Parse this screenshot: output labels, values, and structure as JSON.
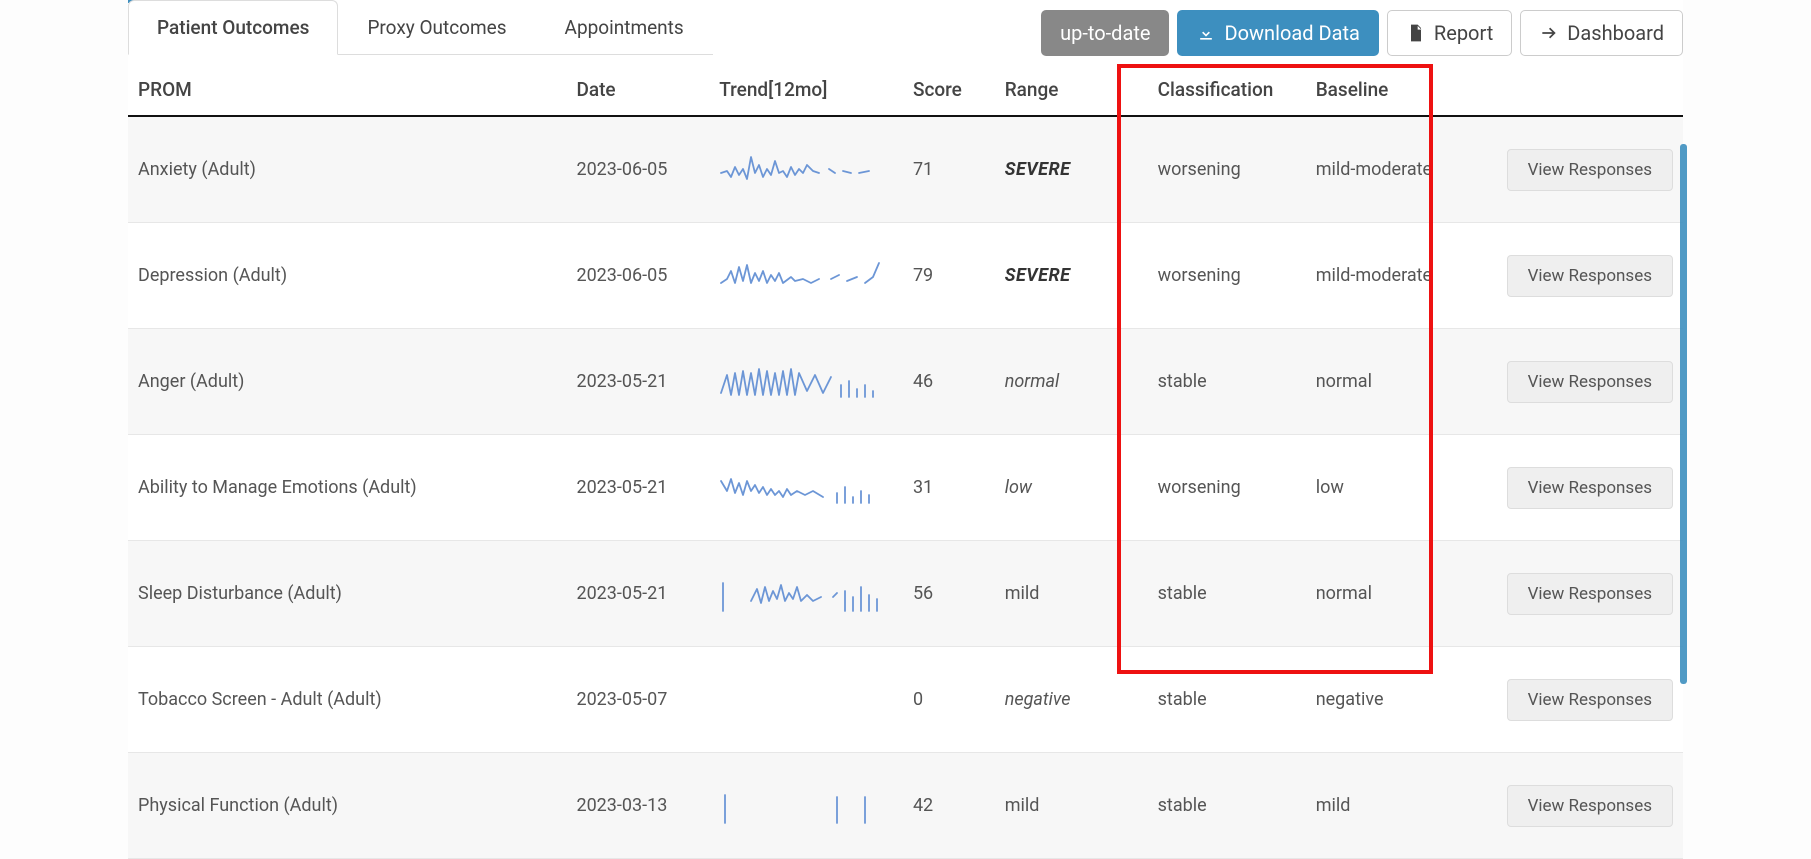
{
  "tabs": {
    "patient": "Patient Outcomes",
    "proxy": "Proxy Outcomes",
    "appts": "Appointments"
  },
  "actions": {
    "uptodate": "up-to-date",
    "download": "Download Data",
    "report": "Report",
    "dashboard": "Dashboard"
  },
  "columns": {
    "prom": "PROM",
    "date": "Date",
    "trend": "Trend[12mo]",
    "score": "Score",
    "range": "Range",
    "classification": "Classification",
    "baseline": "Baseline"
  },
  "view_label": "View Responses",
  "rows": [
    {
      "prom": "Anxiety (Adult)",
      "date": "2023-06-05",
      "score": "71",
      "range": "SEVERE",
      "range_style": "severe",
      "classification": "worsening",
      "baseline": "mild-moderate"
    },
    {
      "prom": "Depression (Adult)",
      "date": "2023-06-05",
      "score": "79",
      "range": "SEVERE",
      "range_style": "severe",
      "classification": "worsening",
      "baseline": "mild-moderate"
    },
    {
      "prom": "Anger (Adult)",
      "date": "2023-05-21",
      "score": "46",
      "range": "normal",
      "range_style": "italic",
      "classification": "stable",
      "baseline": "normal"
    },
    {
      "prom": "Ability to Manage Emotions (Adult)",
      "date": "2023-05-21",
      "score": "31",
      "range": "low",
      "range_style": "italic",
      "classification": "worsening",
      "baseline": "low"
    },
    {
      "prom": "Sleep Disturbance (Adult)",
      "date": "2023-05-21",
      "score": "56",
      "range": "mild",
      "range_style": "plain",
      "classification": "stable",
      "baseline": "normal"
    },
    {
      "prom": "Tobacco Screen - Adult (Adult)",
      "date": "2023-05-07",
      "score": "0",
      "range": "negative",
      "range_style": "italic",
      "classification": "stable",
      "baseline": "negative"
    },
    {
      "prom": "Physical Function (Adult)",
      "date": "2023-03-13",
      "score": "42",
      "range": "mild",
      "range_style": "plain",
      "classification": "stable",
      "baseline": "mild"
    }
  ]
}
